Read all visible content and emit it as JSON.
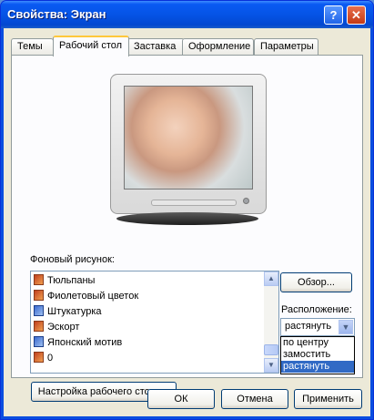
{
  "window": {
    "title": "Свойства: Экран",
    "help_label": "?",
    "close_label": "✕"
  },
  "tabs": [
    {
      "label": "Темы"
    },
    {
      "label": "Рабочий стол"
    },
    {
      "label": "Заставка"
    },
    {
      "label": "Оформление"
    },
    {
      "label": "Параметры"
    }
  ],
  "wallpaper": {
    "label": "Фоновый рисунок:",
    "items": [
      {
        "label": "Тюльпаны",
        "icon": "image-file-icon"
      },
      {
        "label": "Фиолетовый цветок",
        "icon": "image-file-icon"
      },
      {
        "label": "Штукатурка",
        "icon": "pattern-file-icon"
      },
      {
        "label": "Эскорт",
        "icon": "image-file-icon"
      },
      {
        "label": "Японский мотив",
        "icon": "pattern-file-icon"
      },
      {
        "label": "0",
        "icon": "image-file-icon"
      }
    ],
    "browse_label": "Обзор..."
  },
  "position": {
    "label": "Расположение:",
    "selected": "растянуть",
    "options": [
      "по центру",
      "замостить",
      "растянуть"
    ]
  },
  "customize_label": "Настройка рабочего стола...",
  "footer": {
    "ok": "ОК",
    "cancel": "Отмена",
    "apply": "Применить"
  },
  "colors": {
    "titlebar": "#0554e6",
    "selection": "#316ac5",
    "tab_highlight": "#ffc83c"
  }
}
